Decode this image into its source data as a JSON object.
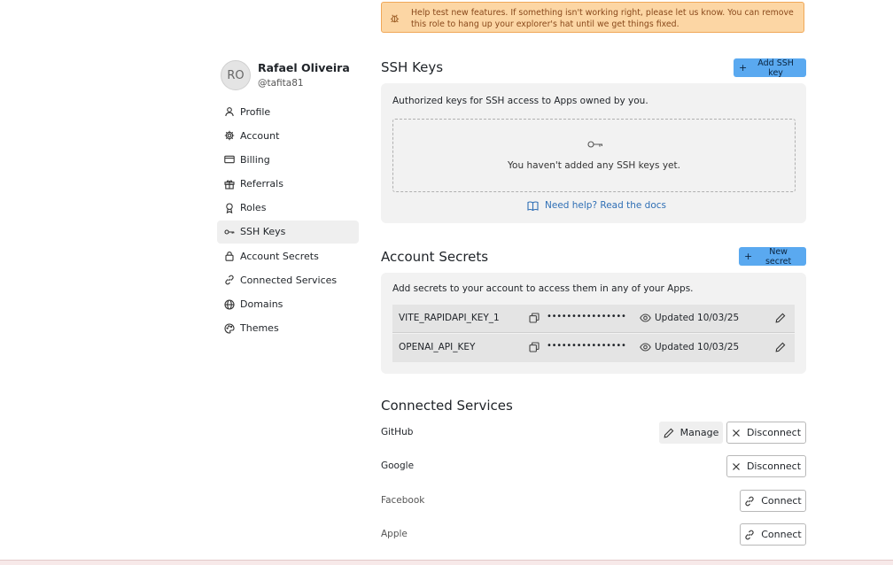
{
  "banner": {
    "text": "Help test new features. If something isn't working right, please let us know. You can remove this role to hang up your explorer's hat until we get things fixed.",
    "icon": "bug-icon"
  },
  "user": {
    "initials": "RO",
    "name": "Rafael Oliveira",
    "handle": "@tafita81"
  },
  "sidebar": {
    "items": [
      {
        "label": "Profile",
        "icon": "person-icon"
      },
      {
        "label": "Account",
        "icon": "gear-icon"
      },
      {
        "label": "Billing",
        "icon": "credit-card-icon"
      },
      {
        "label": "Referrals",
        "icon": "gift-icon"
      },
      {
        "label": "Roles",
        "icon": "badge-icon"
      },
      {
        "label": "SSH Keys",
        "icon": "key-icon",
        "active": true
      },
      {
        "label": "Account Secrets",
        "icon": "lock-icon"
      },
      {
        "label": "Connected Services",
        "icon": "link-icon"
      },
      {
        "label": "Domains",
        "icon": "globe-icon"
      },
      {
        "label": "Themes",
        "icon": "palette-icon"
      }
    ]
  },
  "ssh": {
    "title": "SSH Keys",
    "add_label": "Add SSH key",
    "description": "Authorized keys for SSH access to Apps owned by you.",
    "empty_text": "You haven't added any SSH keys yet.",
    "help_link": "Need help? Read the docs"
  },
  "secrets": {
    "title": "Account Secrets",
    "new_label": "New secret",
    "description": "Add secrets to your account to access them in any of your Apps.",
    "rows": [
      {
        "name": "VITE_RAPIDAPI_KEY_1",
        "masked": "••••••••••••••••",
        "updated": "Updated 10/03/25"
      },
      {
        "name": "OPENAI_API_KEY",
        "masked": "••••••••••••••••",
        "updated": "Updated 10/03/25"
      }
    ]
  },
  "services": {
    "title": "Connected Services",
    "items": [
      {
        "name": "GitHub",
        "manage_label": "Manage",
        "action_label": "Disconnect"
      },
      {
        "name": "Google",
        "action_label": "Disconnect"
      },
      {
        "name": "Facebook",
        "action_label": "Connect"
      },
      {
        "name": "Apple",
        "action_label": "Connect"
      }
    ]
  },
  "colors": {
    "accent": "#5aa9f0",
    "banner_bg": "#fcd6a4",
    "banner_border": "#f0a858",
    "card_bg": "#f2f2f2",
    "link": "#2f6fb5"
  }
}
